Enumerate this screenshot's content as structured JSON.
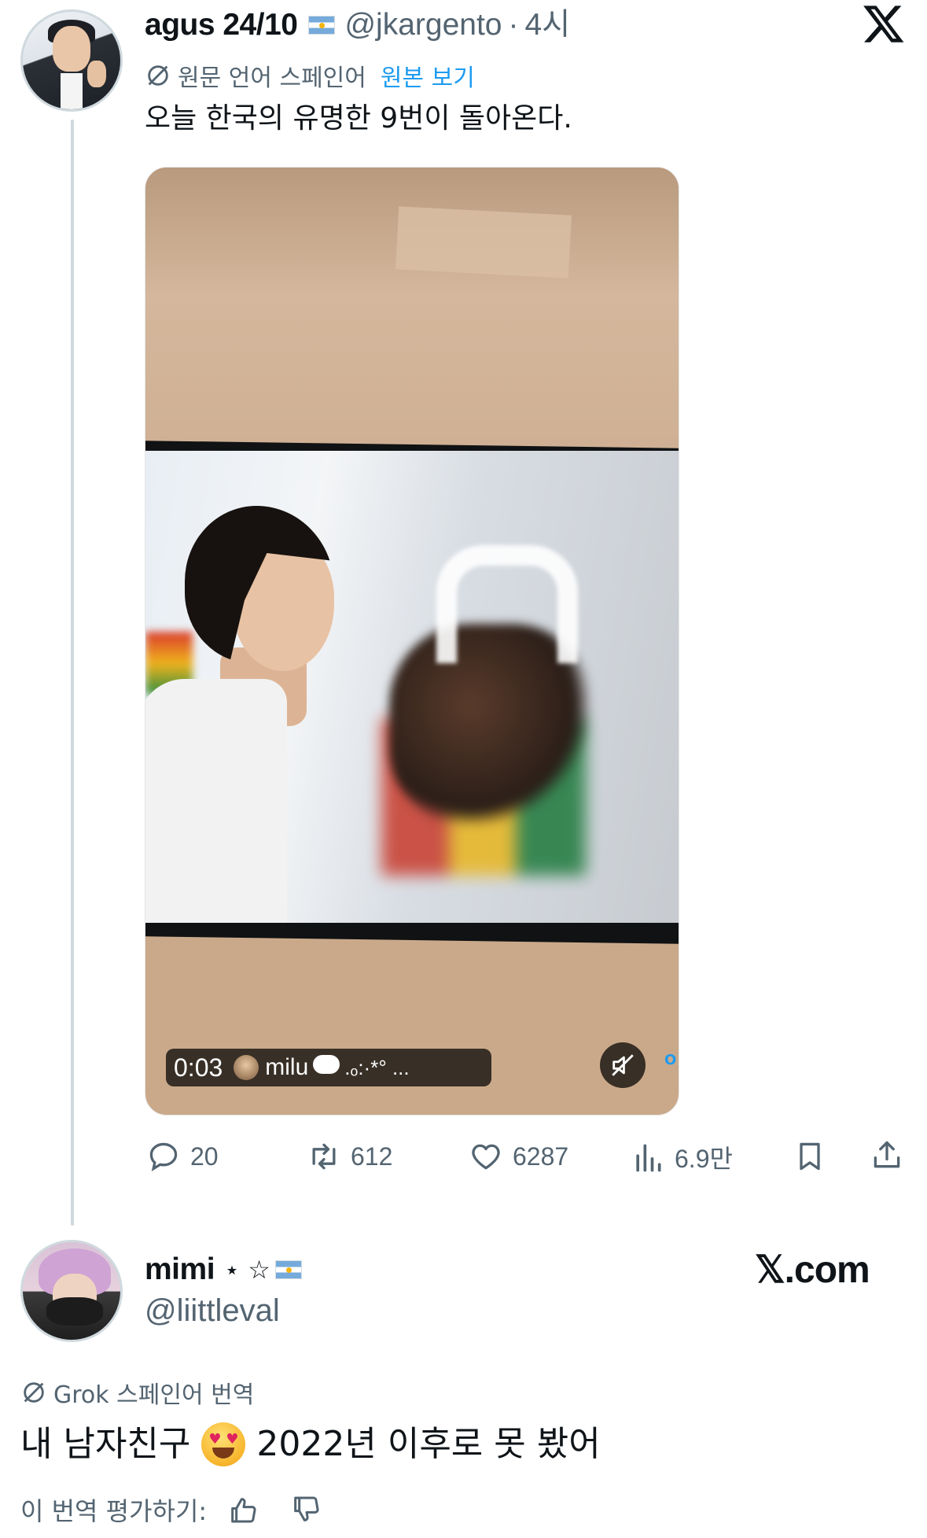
{
  "tweet": {
    "display_name": "agus 24/10",
    "handle": "@jkargento",
    "separator": "·",
    "time": "4시",
    "translation_label": "원문 언어 스페인어",
    "show_original_label": "원본 보기",
    "text": "오늘 한국의 유명한 9번이 돌아온다.",
    "media": {
      "time": "0:03",
      "creator": "milu",
      "creator_suffix": ".ₒ:·*°  ...",
      "corner_text": "O"
    },
    "actions": {
      "replies": "20",
      "reposts": "612",
      "likes": "6287",
      "views": "6.9만"
    },
    "icons": [
      "globe-slash-icon",
      "reply-icon",
      "repost-icon",
      "like-icon",
      "views-icon",
      "bookmark-icon",
      "share-icon",
      "mute-icon",
      "x-logo-icon"
    ]
  },
  "reply": {
    "display_name": "mimi",
    "name_suffix": "⋆ ☆",
    "handle": "@liittleval",
    "brand": "𝕏.com",
    "translation_label": "Grok 스페인어 번역",
    "text_before": "내 남자친구",
    "text_after": "2022년 이후로 못 봤어",
    "rate_label": "이 번역 평가하기:",
    "icons": [
      "heart-eyes-emoji",
      "thumbs-up-icon",
      "thumbs-down-icon"
    ]
  },
  "colors": {
    "text_primary": "#0f1419",
    "text_secondary": "#536471",
    "link": "#1d9bf0",
    "thread_line": "#cfd9de"
  }
}
